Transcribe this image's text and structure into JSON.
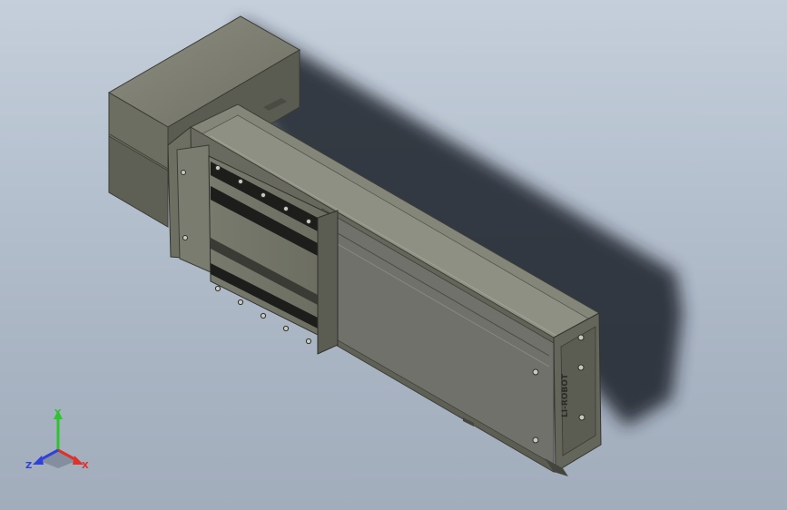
{
  "viewport": {
    "background_top": "#c5cfdb",
    "background_bottom": "#a2adbc"
  },
  "model": {
    "body_color": "#76776a",
    "body_dark": "#4f5048",
    "body_light": "#8e8f82",
    "shadow_color": "#1f232b",
    "brand_text": "LI-ROBOT"
  },
  "triad": {
    "x_label": "X",
    "y_label": "Y",
    "z_label": "Z",
    "x_color": "#e0302a",
    "y_color": "#2ec42e",
    "z_color": "#3040d8"
  }
}
